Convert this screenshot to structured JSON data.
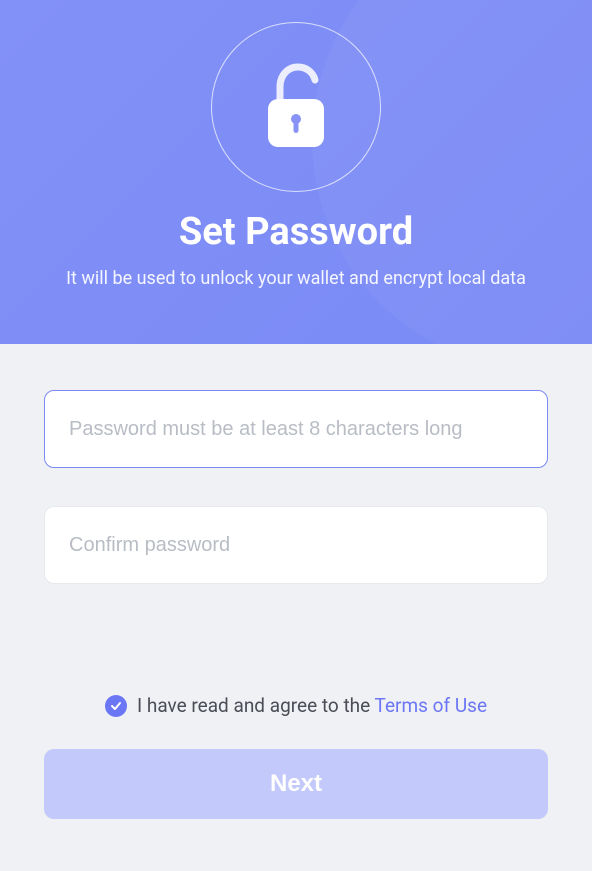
{
  "header": {
    "title": "Set Password",
    "subtitle": "It will be used to unlock your wallet and encrypt local data"
  },
  "form": {
    "password": {
      "value": "",
      "placeholder": "Password must be at least 8 characters long"
    },
    "confirmPassword": {
      "value": "",
      "placeholder": "Confirm password"
    }
  },
  "agreement": {
    "checked": true,
    "textPrefix": "I have read and agree to the ",
    "linkText": "Terms of Use"
  },
  "actions": {
    "nextLabel": "Next"
  }
}
